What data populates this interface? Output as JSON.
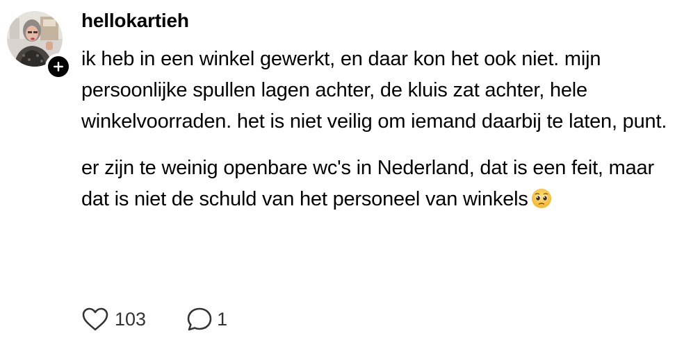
{
  "post": {
    "username": "hellokartieh",
    "paragraphs": [
      "ik heb in een winkel gewerkt, en daar kon het ook niet. mijn persoonlijke spullen lagen achter, de kluis zat achter, hele winkelvoorraden. het is niet veilig om iemand daarbij te laten, punt.",
      "er zijn te weinig openbare wc's in Nederland, dat is een feit, maar dat is niet de schuld van het personeel van winkels"
    ],
    "emoji": "pleading-face-emoji",
    "actions": {
      "likes_count": "103",
      "replies_count": "1"
    }
  },
  "icons": {
    "like": "heart-icon",
    "reply": "speech-bubble-icon",
    "follow": "plus-icon"
  },
  "colors": {
    "text": "#000000",
    "muted": "#333333",
    "background": "#ffffff"
  }
}
